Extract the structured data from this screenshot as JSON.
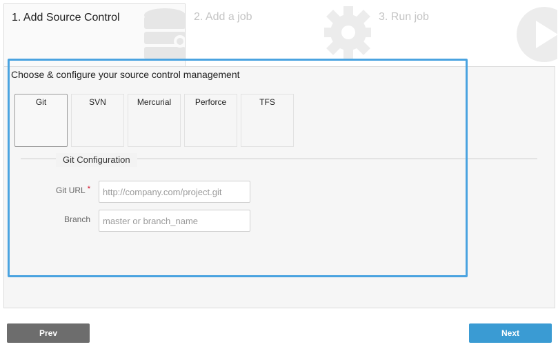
{
  "wizard": {
    "steps": [
      {
        "label": "1. Add Source Control",
        "icon": "database-icon",
        "active": true
      },
      {
        "label": "2. Add a job",
        "icon": "gear-icon",
        "active": false
      },
      {
        "label": "3. Run job",
        "icon": "play-icon",
        "active": false
      }
    ]
  },
  "main": {
    "heading": "Choose & configure your source control management",
    "scm_options": [
      {
        "label": "Git",
        "selected": true
      },
      {
        "label": "SVN",
        "selected": false
      },
      {
        "label": "Mercurial",
        "selected": false
      },
      {
        "label": "Perforce",
        "selected": false
      },
      {
        "label": "TFS",
        "selected": false
      }
    ],
    "config_title": "Git Configuration",
    "fields": {
      "git_url": {
        "label": "Git URL",
        "required_mark": "*",
        "value": "",
        "placeholder": "http://company.com/project.git"
      },
      "branch": {
        "label": "Branch",
        "value": "",
        "placeholder": "master or branch_name"
      }
    }
  },
  "footer": {
    "prev_label": "Prev",
    "next_label": "Next"
  },
  "colors": {
    "accent": "#3a9bd3",
    "highlight_border": "#4aa3e0",
    "prev_button": "#6d6d6d",
    "required": "#d0021b"
  }
}
